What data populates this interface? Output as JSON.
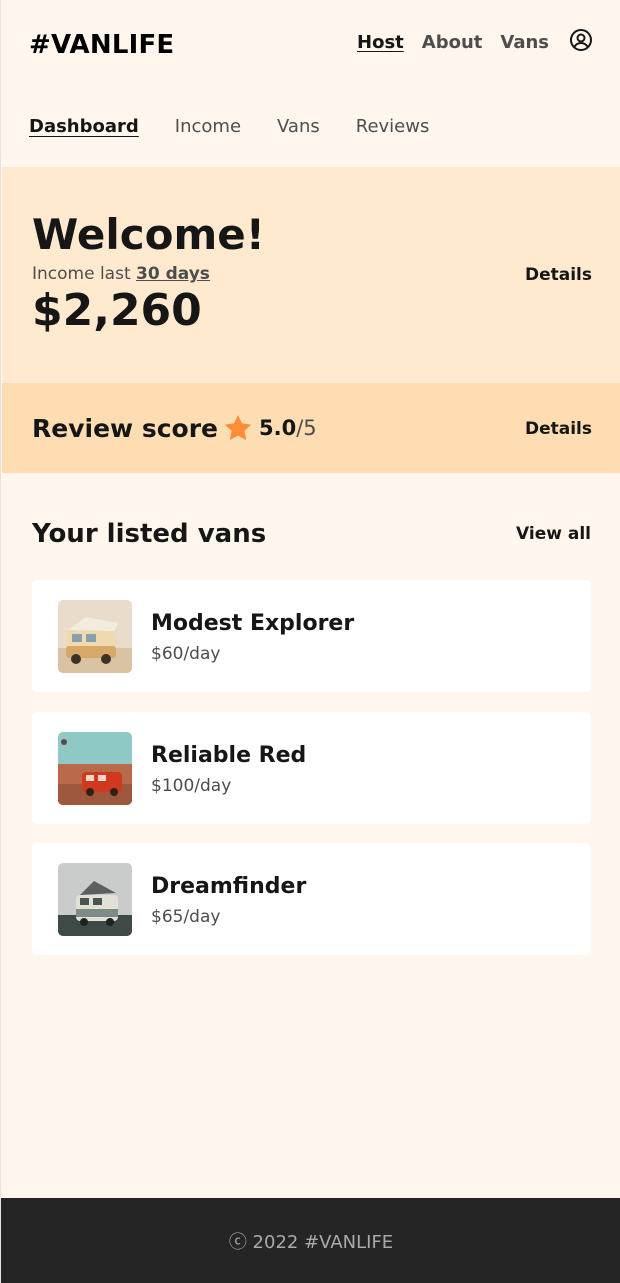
{
  "header": {
    "logo": "#VANLIFE",
    "nav": {
      "host": "Host",
      "about": "About",
      "vans": "Vans"
    },
    "user_icon": "user-circle-icon"
  },
  "subnav": {
    "dashboard": "Dashboard",
    "income": "Income",
    "vans": "Vans",
    "reviews": "Reviews"
  },
  "income": {
    "title": "Welcome!",
    "label_prefix": "Income last",
    "label_period": "30 days",
    "amount": "$2,260",
    "details": "Details"
  },
  "review": {
    "title": "Review score",
    "star_icon": "star-icon",
    "score": "5.0",
    "out_of": "/5",
    "details": "Details"
  },
  "vans": {
    "title": "Your listed vans",
    "view_all": "View all",
    "items": [
      {
        "name": "Modest Explorer",
        "price": "$60/day"
      },
      {
        "name": "Reliable Red",
        "price": "$100/day"
      },
      {
        "name": "Dreamfinder",
        "price": "$65/day"
      }
    ]
  },
  "footer": {
    "text": "ⓒ 2022 #VANLIFE"
  },
  "colors": {
    "background": "#FFF7ED",
    "income_bg": "#FFEAD0",
    "review_bg": "#FFDDB2",
    "star": "#FF8C38",
    "footer_bg": "#252525"
  }
}
